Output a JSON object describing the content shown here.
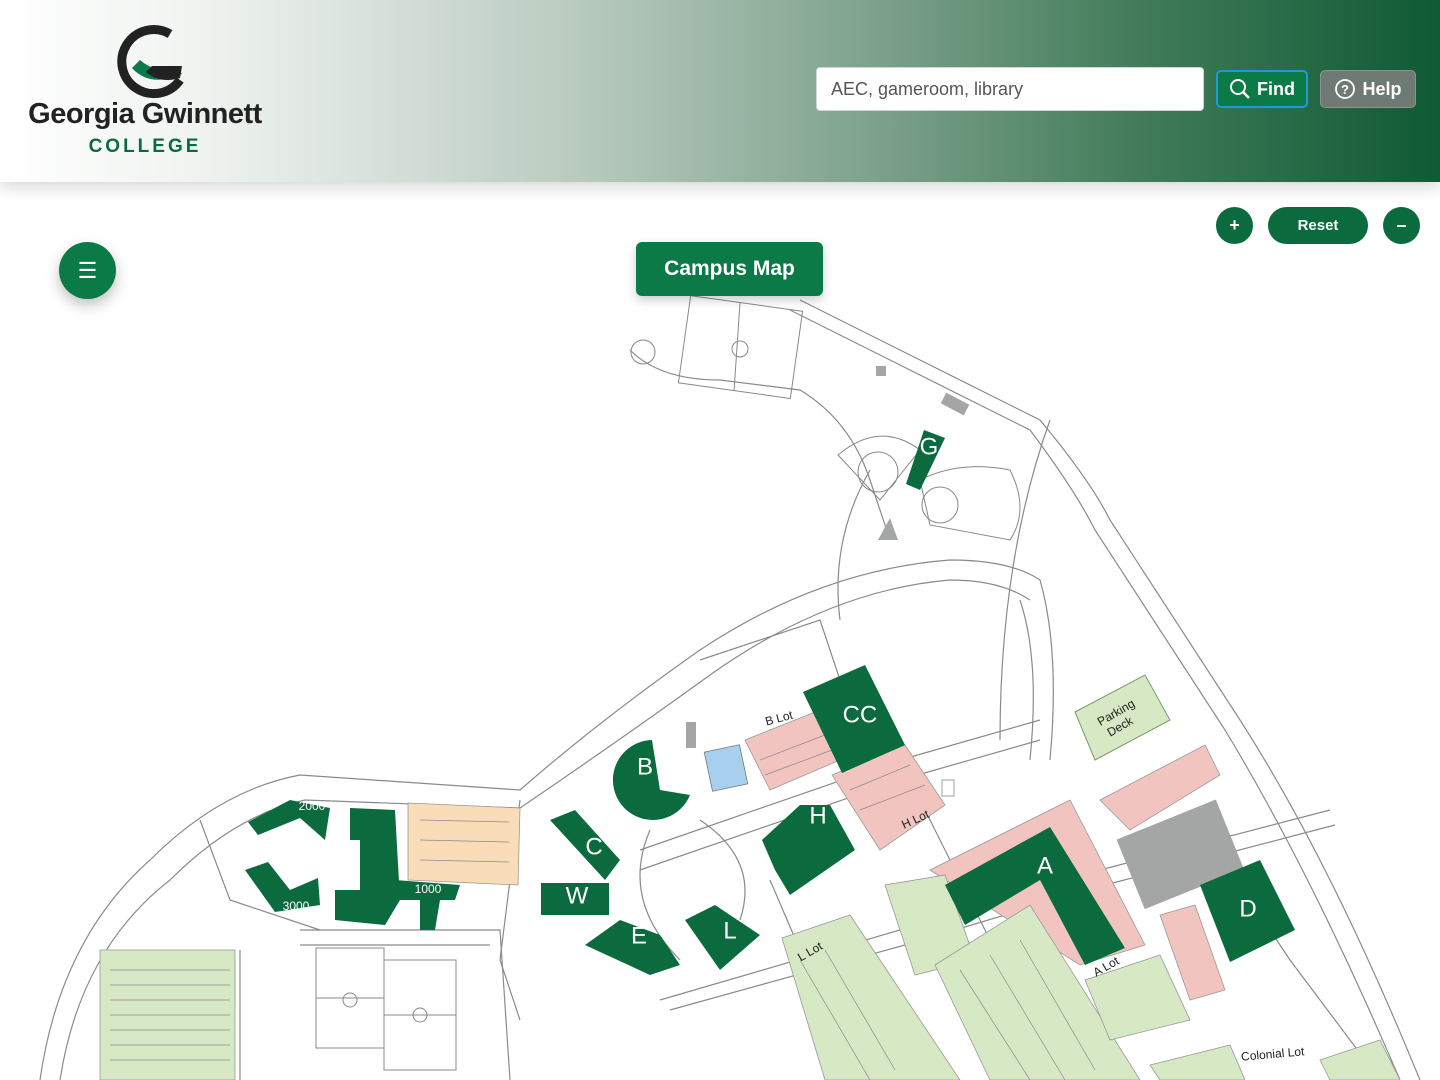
{
  "header": {
    "logo_name": "Georgia Gwinnett",
    "logo_college": "COLLEGE",
    "search_placeholder": "AEC, gameroom, library",
    "find_label": "Find",
    "help_label": "Help"
  },
  "controls": {
    "menu_icon": "hamburger-icon",
    "title": "Campus Map",
    "zoom_in": "+",
    "reset": "Reset",
    "zoom_out": "–"
  },
  "map": {
    "buildings": {
      "G": "G",
      "CC": "CC",
      "B": "B",
      "H": "H",
      "C": "C",
      "W": "W",
      "A": "A",
      "D": "D",
      "E": "E",
      "L": "L"
    },
    "housing": {
      "h2000": "2000",
      "h3000": "3000",
      "h1000": "1000"
    },
    "lots": {
      "b_lot": "B Lot",
      "h_lot": "H Lot",
      "l_lot": "L Lot",
      "a_lot": "A Lot",
      "colonial_lot": "Colonial Lot",
      "parking_deck_1": "Parking",
      "parking_deck_2": "Deck"
    },
    "colors": {
      "building": "#0b6b3f",
      "parking_red": "#f2c4c0",
      "parking_green": "#d6e8c4",
      "parking_orange": "#f9dcb8",
      "blue": "#a9cfee",
      "gray": "#a4a6a5"
    }
  }
}
